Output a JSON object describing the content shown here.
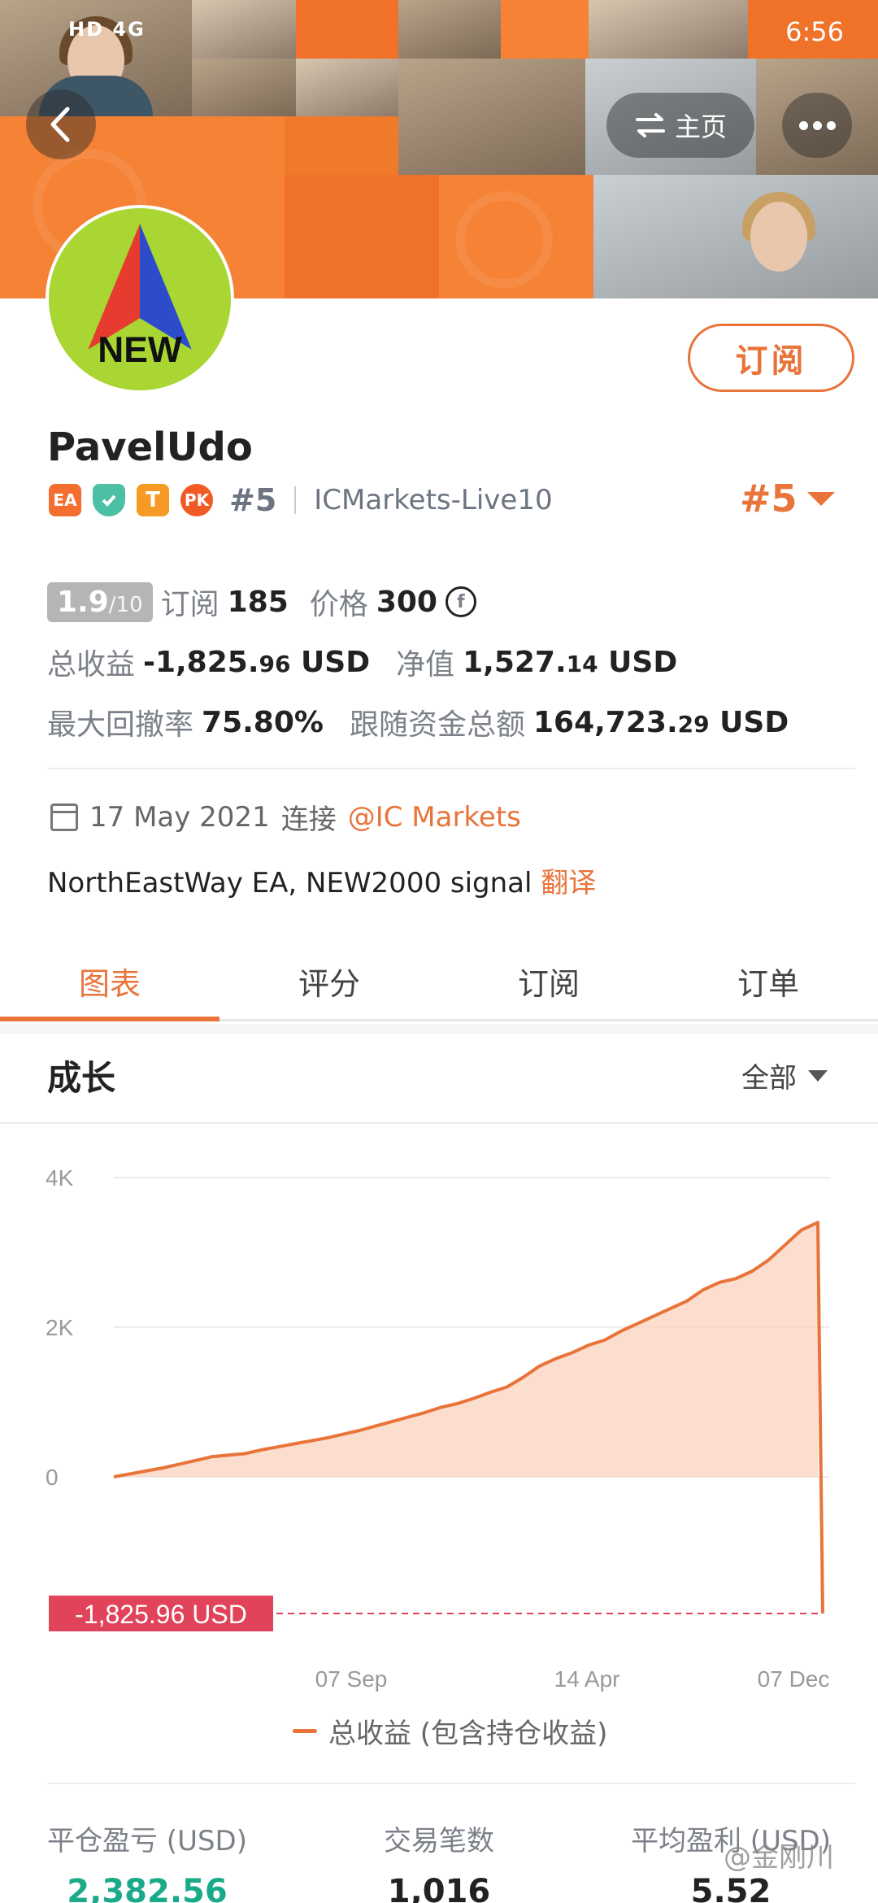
{
  "status_bar": {
    "left": "HD 4G",
    "time": "6:56"
  },
  "header": {
    "home_label": "主页"
  },
  "profile": {
    "avatar_text": "NEW",
    "subscribe_label": "订阅",
    "name": "PavelUdo",
    "badges": [
      "EA",
      "T",
      "PK"
    ],
    "rank_inline": "#5",
    "broker": "ICMarkets-Live10",
    "rank_right": "#5"
  },
  "stats": {
    "score": "1.9",
    "score_den": "/10",
    "subs_label": "订阅",
    "subs_value": "185",
    "price_label": "价格",
    "price_value": "300",
    "price_coin": "f",
    "total_label": "总收益",
    "total_value_main": "-1,825.",
    "total_value_dec": "96",
    "total_unit": "USD",
    "equity_label": "净值",
    "equity_main": "1,527.",
    "equity_dec": "14",
    "equity_unit": "USD",
    "dd_label": "最大回撤率",
    "dd_value": "75.80%",
    "funds_label": "跟随资金总额",
    "funds_main": "164,723.",
    "funds_dec": "29",
    "funds_unit": "USD"
  },
  "info": {
    "date": "17 May 2021",
    "connect_label": "连接",
    "broker_link": "@IC Markets",
    "description": "NorthEastWay EA, NEW2000 signal",
    "translate": "翻译"
  },
  "tabs": [
    "图表",
    "评分",
    "订阅",
    "订单"
  ],
  "growth": {
    "title": "成长",
    "filter": "全部"
  },
  "chart_data": {
    "type": "area",
    "title": "成长",
    "y_ticks": [
      "4K",
      "2K",
      "0"
    ],
    "ylim": [
      -1825.96,
      4000
    ],
    "x_ticks": [
      "07 Sep",
      "14 Apr",
      "07 Dec"
    ],
    "values": [
      0,
      40,
      80,
      120,
      170,
      220,
      270,
      290,
      310,
      360,
      400,
      440,
      480,
      520,
      570,
      620,
      680,
      740,
      800,
      860,
      930,
      980,
      1050,
      1130,
      1200,
      1330,
      1480,
      1580,
      1660,
      1760,
      1830,
      1950,
      2050,
      2150,
      2250,
      2350,
      2500,
      2600,
      2650,
      2750,
      2900,
      3100,
      3300,
      3400,
      -1825.96
    ],
    "current_label": "-1,825.96 USD",
    "legend": "总收益 (包含持仓收益)",
    "colors": {
      "line": "#e8743a",
      "fill": "#fbd3bd",
      "marker": "#e0435a"
    }
  },
  "bottom_stats": [
    {
      "label": "平仓盈亏 (USD)",
      "value": "2,382.56"
    },
    {
      "label": "交易笔数",
      "value": "1,016"
    },
    {
      "label": "平均盈利 (USD)",
      "value": "5.52"
    }
  ],
  "watermark": "@金刚川"
}
